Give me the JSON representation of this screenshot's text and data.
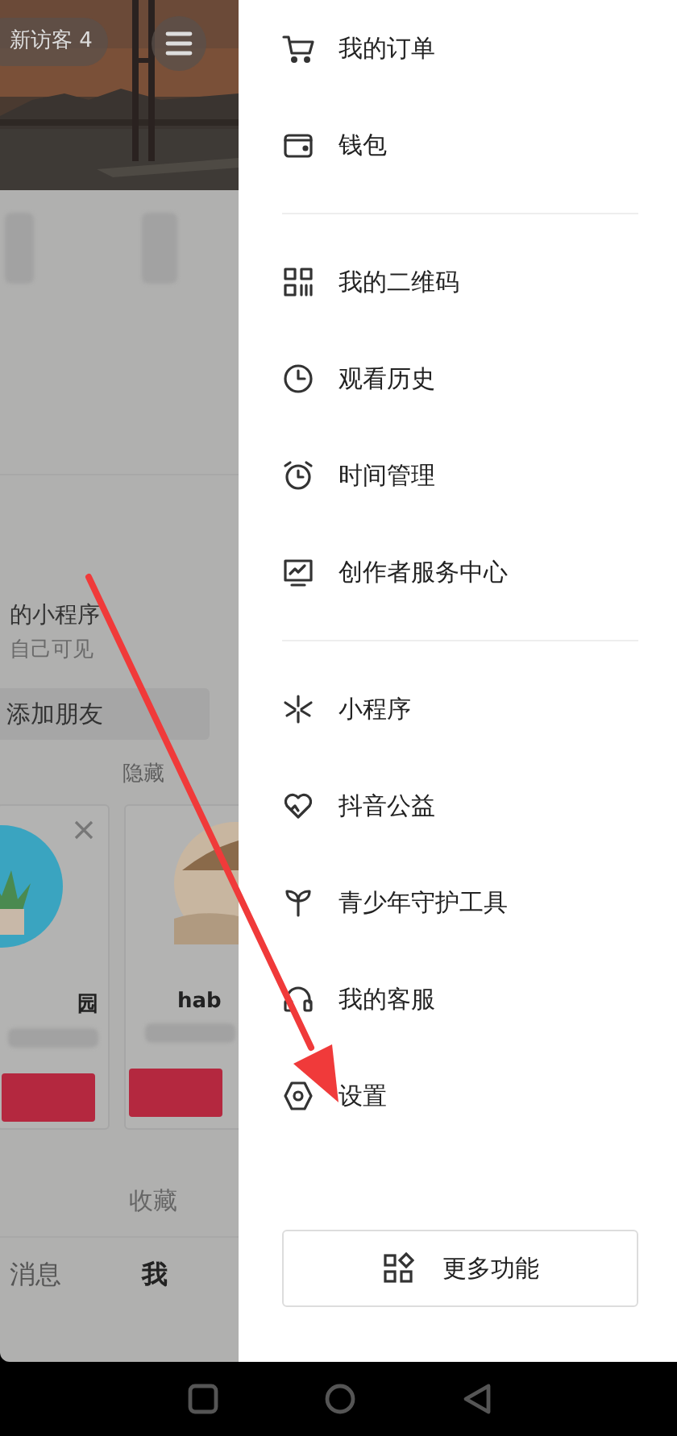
{
  "left_panel": {
    "visitor_badge": "新访客 4",
    "mini_programs": {
      "title": "的小程序",
      "subtitle": "自己可见"
    },
    "add_friend_button": "添加朋友",
    "hide_link": "隐藏",
    "suggestion_cards": [
      {
        "name": "园",
        "closable": true
      },
      {
        "name": "hab",
        "closable": false
      }
    ],
    "content_tab": "收藏",
    "bottom_nav": [
      {
        "label": "消息",
        "selected": false
      },
      {
        "label": "我",
        "selected": true
      }
    ]
  },
  "drawer": {
    "groups": [
      [
        {
          "kind": "cart",
          "label": "我的订单"
        },
        {
          "kind": "wallet",
          "label": "钱包"
        }
      ],
      [
        {
          "kind": "qrcode",
          "label": "我的二维码"
        },
        {
          "kind": "clock",
          "label": "观看历史"
        },
        {
          "kind": "alarm",
          "label": "时间管理"
        },
        {
          "kind": "monitor",
          "label": "创作者服务中心"
        }
      ],
      [
        {
          "kind": "spark",
          "label": "小程序"
        },
        {
          "kind": "heart",
          "label": "抖音公益"
        },
        {
          "kind": "sprout",
          "label": "青少年守护工具"
        },
        {
          "kind": "headset",
          "label": "我的客服"
        },
        {
          "kind": "hexagon",
          "label": "设置"
        }
      ]
    ],
    "more_button": {
      "label": "更多功能"
    }
  }
}
